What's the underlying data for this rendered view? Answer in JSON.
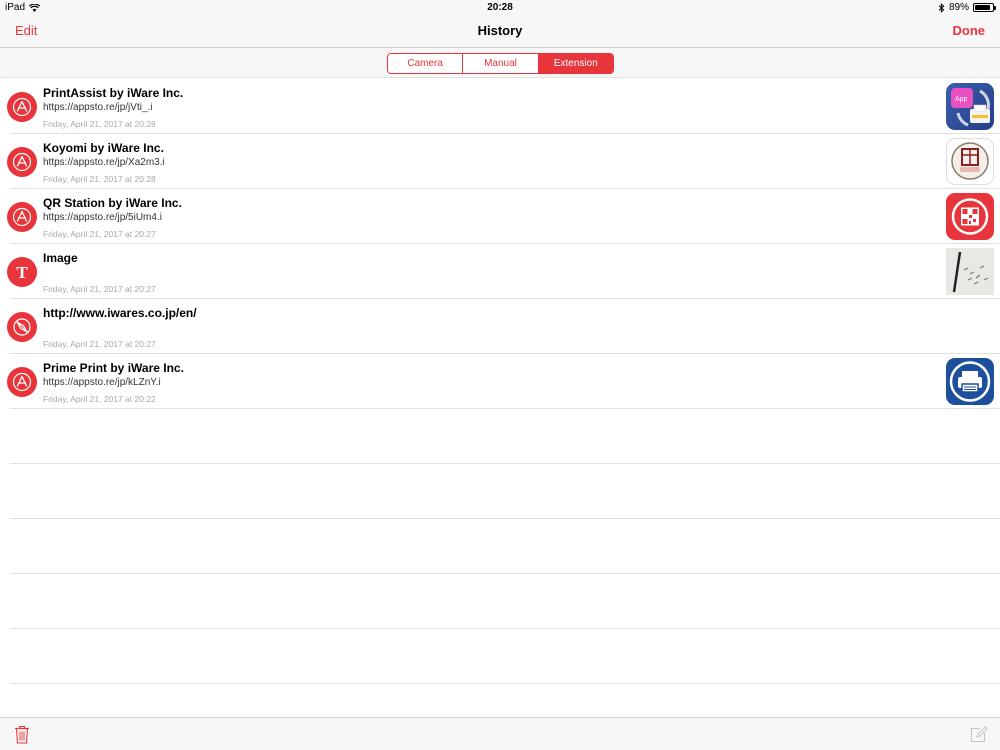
{
  "status": {
    "device": "iPad",
    "time": "20:28",
    "battery": "89%",
    "battery_level": 0.89
  },
  "nav": {
    "edit_label": "Edit",
    "title": "History",
    "done_label": "Done"
  },
  "segments": [
    {
      "label": "Camera",
      "selected": false
    },
    {
      "label": "Manual",
      "selected": false
    },
    {
      "label": "Extension",
      "selected": true
    }
  ],
  "colors": {
    "accent": "#e8353b"
  },
  "rows": [
    {
      "title": "PrintAssist by iWare Inc.",
      "url": "https://appsto.re/jp/jVti_.i",
      "date": "Friday, April 21, 2017 at 20:28",
      "icon": "app-store-icon",
      "thumbnail": "printassist-app-icon"
    },
    {
      "title": "Koyomi by iWare Inc.",
      "url": "https://appsto.re/jp/Xa2m3.i",
      "date": "Friday, April 21, 2017 at 20:28",
      "icon": "app-store-icon",
      "thumbnail": "koyomi-app-icon"
    },
    {
      "title": "QR Station by iWare Inc.",
      "url": "https://appsto.re/jp/5iUm4.i",
      "date": "Friday, April 21, 2017 at 20:27",
      "icon": "app-store-icon",
      "thumbnail": "qr-station-app-icon"
    },
    {
      "title": "Image",
      "url": "",
      "date": "Friday, April 21, 2017 at 20:27",
      "icon": "text-icon",
      "thumbnail": "image-photo"
    },
    {
      "title": "http://www.iwares.co.jp/en/",
      "url": "",
      "date": "Friday, April 21, 2017 at 20:27",
      "icon": "compass-icon",
      "thumbnail": ""
    },
    {
      "title": "Prime Print by iWare Inc.",
      "url": "https://appsto.re/jp/kLZnY.i",
      "date": "Friday, April 21, 2017 at 20:22",
      "icon": "app-store-icon",
      "thumbnail": "prime-print-app-icon"
    }
  ],
  "toolbar": {
    "left_icon": "trash-icon",
    "right_icon": "compose-icon"
  }
}
